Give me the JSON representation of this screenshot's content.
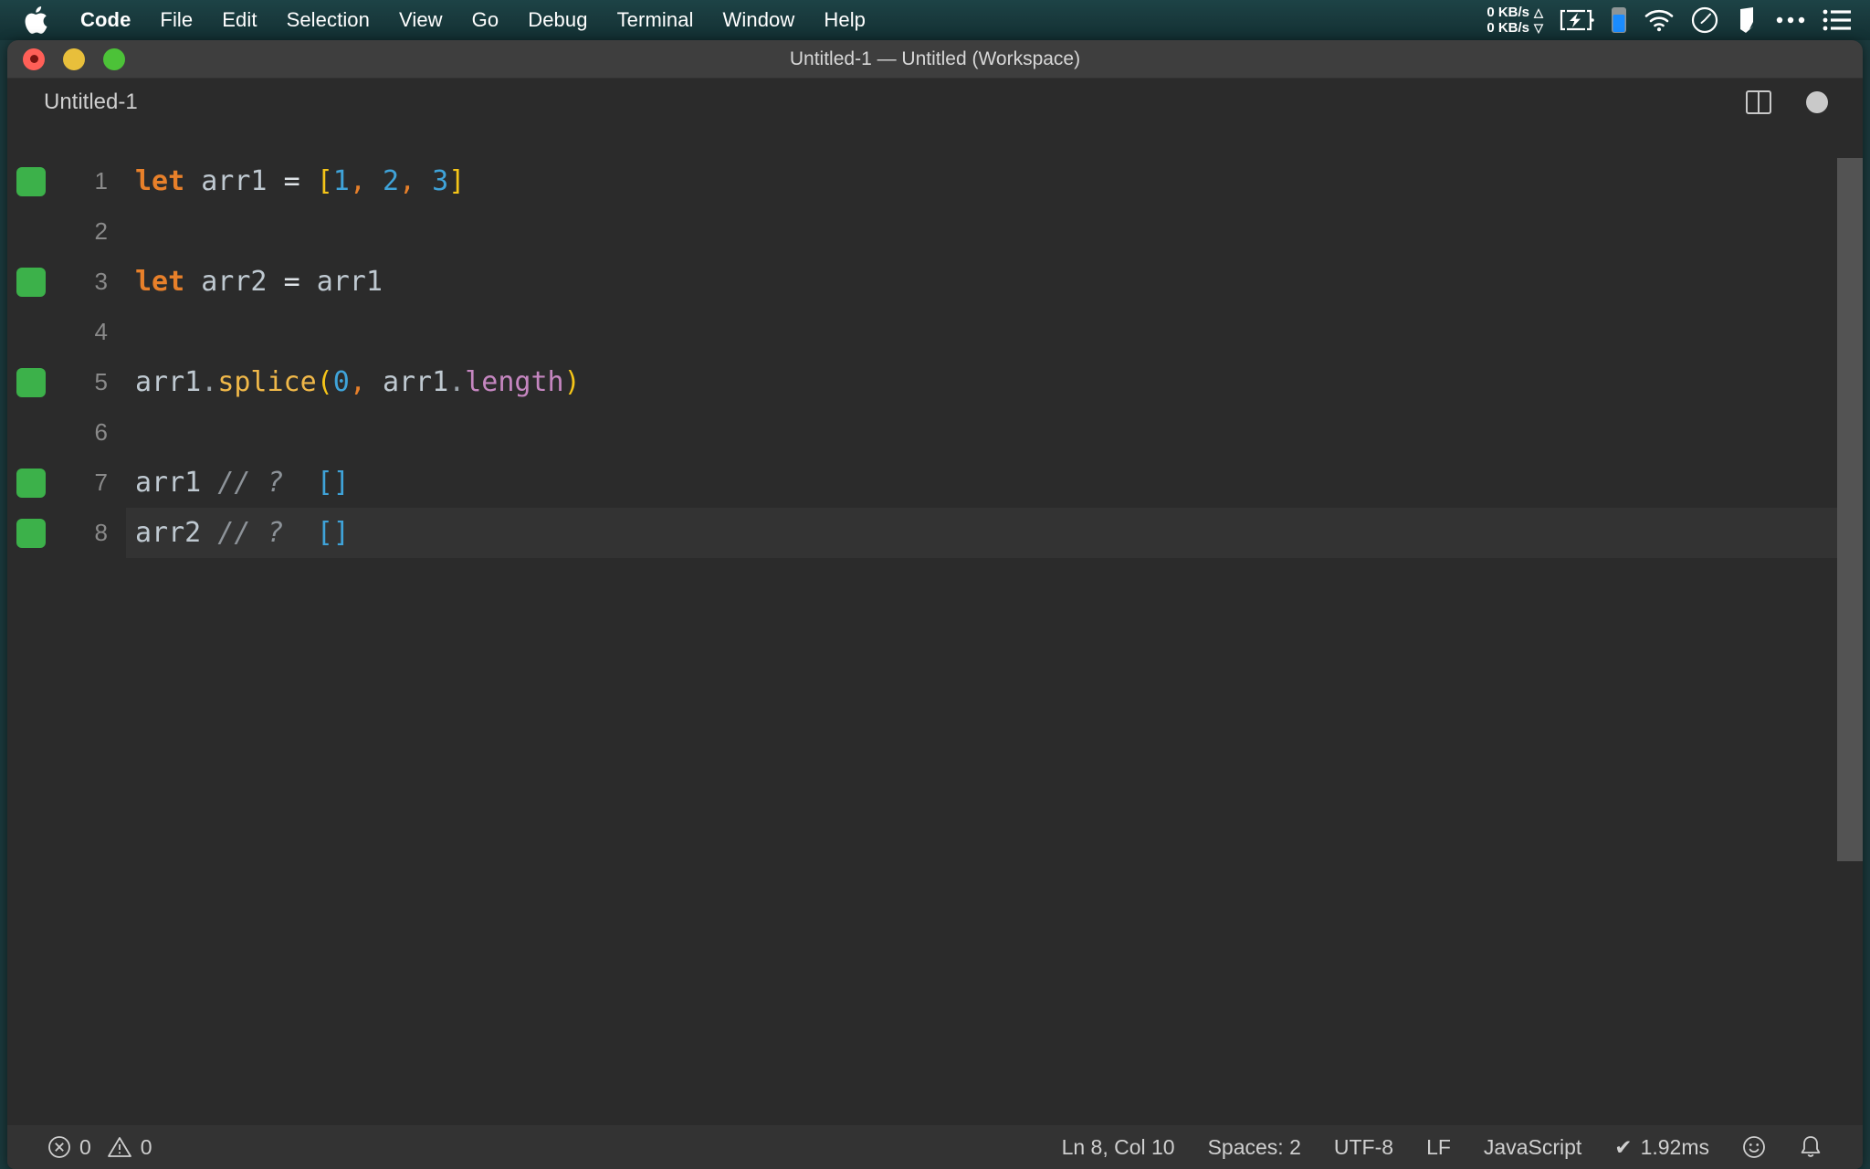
{
  "menubar": {
    "apple_icon": "apple-logo-icon",
    "items": [
      {
        "label": "Code",
        "bold": true
      },
      {
        "label": "File",
        "bold": false
      },
      {
        "label": "Edit",
        "bold": false
      },
      {
        "label": "Selection",
        "bold": false
      },
      {
        "label": "View",
        "bold": false
      },
      {
        "label": "Go",
        "bold": false
      },
      {
        "label": "Debug",
        "bold": false
      },
      {
        "label": "Terminal",
        "bold": false
      },
      {
        "label": "Window",
        "bold": false
      },
      {
        "label": "Help",
        "bold": false
      }
    ],
    "status": {
      "net_up": "0 KB/s",
      "net_down": "0 KB/s",
      "up_arrow": "△",
      "down_arrow": "▽",
      "battery_charging_icon": "battery-charging-icon",
      "battery_level_icon": "battery-level-icon",
      "wifi_icon": "wifi-icon",
      "clock_icon": "clock-icon",
      "app_icon": "app-icon",
      "more_icon": "ellipsis-icon",
      "control_center_icon": "list-menu-icon"
    }
  },
  "window": {
    "title": "Untitled-1 — Untitled (Workspace)",
    "traffic_lights": [
      "close-button",
      "minimize-button",
      "maximize-button"
    ]
  },
  "tabbar": {
    "tab_label": "Untitled-1",
    "split_editor_icon": "split-editor-icon",
    "unsaved_indicator": "unsaved-dot-icon"
  },
  "editor": {
    "language": "JavaScript",
    "lines": [
      {
        "number": "1",
        "marked": true,
        "current": false,
        "tokens": [
          {
            "t": "let",
            "c": "tk-kw"
          },
          {
            "t": " ",
            "c": "tk-op"
          },
          {
            "t": "arr1",
            "c": "tk-var"
          },
          {
            "t": " ",
            "c": "tk-op"
          },
          {
            "t": "=",
            "c": "tk-op"
          },
          {
            "t": " ",
            "c": "tk-op"
          },
          {
            "t": "[",
            "c": "tk-brk"
          },
          {
            "t": "1",
            "c": "tk-num"
          },
          {
            "t": ",",
            "c": "tk-comma"
          },
          {
            "t": " ",
            "c": "tk-op"
          },
          {
            "t": "2",
            "c": "tk-num"
          },
          {
            "t": ",",
            "c": "tk-comma"
          },
          {
            "t": " ",
            "c": "tk-op"
          },
          {
            "t": "3",
            "c": "tk-num"
          },
          {
            "t": "]",
            "c": "tk-brk"
          }
        ]
      },
      {
        "number": "2",
        "marked": false,
        "current": false,
        "tokens": []
      },
      {
        "number": "3",
        "marked": true,
        "current": false,
        "tokens": [
          {
            "t": "let",
            "c": "tk-kw"
          },
          {
            "t": " ",
            "c": "tk-op"
          },
          {
            "t": "arr2",
            "c": "tk-var"
          },
          {
            "t": " ",
            "c": "tk-op"
          },
          {
            "t": "=",
            "c": "tk-op"
          },
          {
            "t": " ",
            "c": "tk-op"
          },
          {
            "t": "arr1",
            "c": "tk-var"
          }
        ]
      },
      {
        "number": "4",
        "marked": false,
        "current": false,
        "tokens": []
      },
      {
        "number": "5",
        "marked": true,
        "current": false,
        "tokens": [
          {
            "t": "arr1",
            "c": "tk-var"
          },
          {
            "t": ".",
            "c": "tk-dot"
          },
          {
            "t": "splice",
            "c": "tk-fn"
          },
          {
            "t": "(",
            "c": "tk-brk"
          },
          {
            "t": "0",
            "c": "tk-num"
          },
          {
            "t": ",",
            "c": "tk-comma"
          },
          {
            "t": " ",
            "c": "tk-op"
          },
          {
            "t": "arr1",
            "c": "tk-var"
          },
          {
            "t": ".",
            "c": "tk-dot"
          },
          {
            "t": "length",
            "c": "tk-prop"
          },
          {
            "t": ")",
            "c": "tk-brk"
          }
        ]
      },
      {
        "number": "6",
        "marked": false,
        "current": false,
        "tokens": []
      },
      {
        "number": "7",
        "marked": true,
        "current": false,
        "tokens": [
          {
            "t": "arr1",
            "c": "tk-var"
          },
          {
            "t": " ",
            "c": "tk-op"
          },
          {
            "t": "// ?",
            "c": "tk-comment"
          },
          {
            "t": "  ",
            "c": "tk-op"
          },
          {
            "t": "[]",
            "c": "tk-result"
          }
        ]
      },
      {
        "number": "8",
        "marked": true,
        "current": true,
        "tokens": [
          {
            "t": "arr2",
            "c": "tk-var"
          },
          {
            "t": " ",
            "c": "tk-op"
          },
          {
            "t": "// ?",
            "c": "tk-comment"
          },
          {
            "t": "  ",
            "c": "tk-op"
          },
          {
            "t": "[]",
            "c": "tk-result"
          }
        ]
      }
    ]
  },
  "statusbar": {
    "errors_icon": "error-circle-icon",
    "errors": "0",
    "warnings_icon": "warning-triangle-icon",
    "warnings": "0",
    "cursor": "Ln 8, Col 10",
    "indentation": "Spaces: 2",
    "encoding": "UTF-8",
    "eol": "LF",
    "language": "JavaScript",
    "runtime_check": "✔",
    "runtime": "1.92ms",
    "feedback_icon": "smiley-icon",
    "notifications_icon": "bell-icon"
  },
  "colors": {
    "menubar_bg": "#18383b",
    "window_bg": "#2b2b2b",
    "titlebar_bg": "#3e3e3e",
    "statusbar_bg": "#333333",
    "current_line": "#333333",
    "gutter_mark": "#3cb14a",
    "keyword": "#e8802a",
    "number": "#3fa3d9",
    "bracket": "#f5c518",
    "function": "#f0b849",
    "property": "#c586c0",
    "comment": "#8d9399"
  }
}
